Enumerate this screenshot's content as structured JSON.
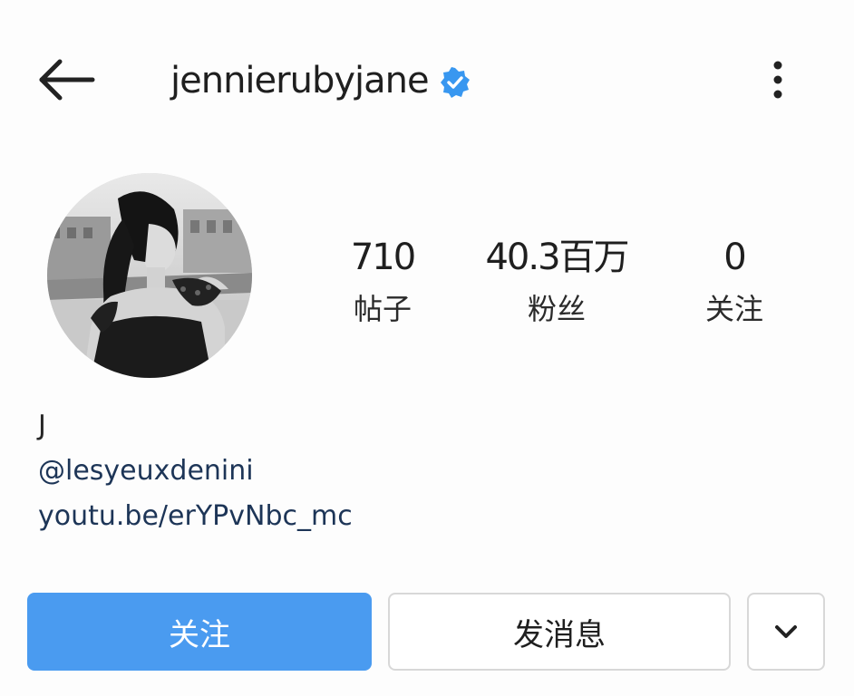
{
  "header": {
    "username": "jennierubyjane",
    "verified_color": "#3897f0"
  },
  "profile": {
    "stats": [
      {
        "value": "710",
        "label": "帖子"
      },
      {
        "value": "40.3百万",
        "label": "粉丝"
      },
      {
        "value": "0",
        "label": "关注"
      }
    ],
    "bio": {
      "name": "J",
      "mention": "@lesyeuxdenini",
      "link": "youtu.be/erYPvNbc_mc"
    }
  },
  "actions": {
    "follow_label": "关注",
    "message_label": "发消息",
    "follow_color": "#4a9bf0"
  },
  "icons": {
    "back": "arrow-left-icon",
    "more": "three-dots-vertical-icon",
    "verified": "verified-badge-icon",
    "dropdown": "chevron-down-icon"
  }
}
